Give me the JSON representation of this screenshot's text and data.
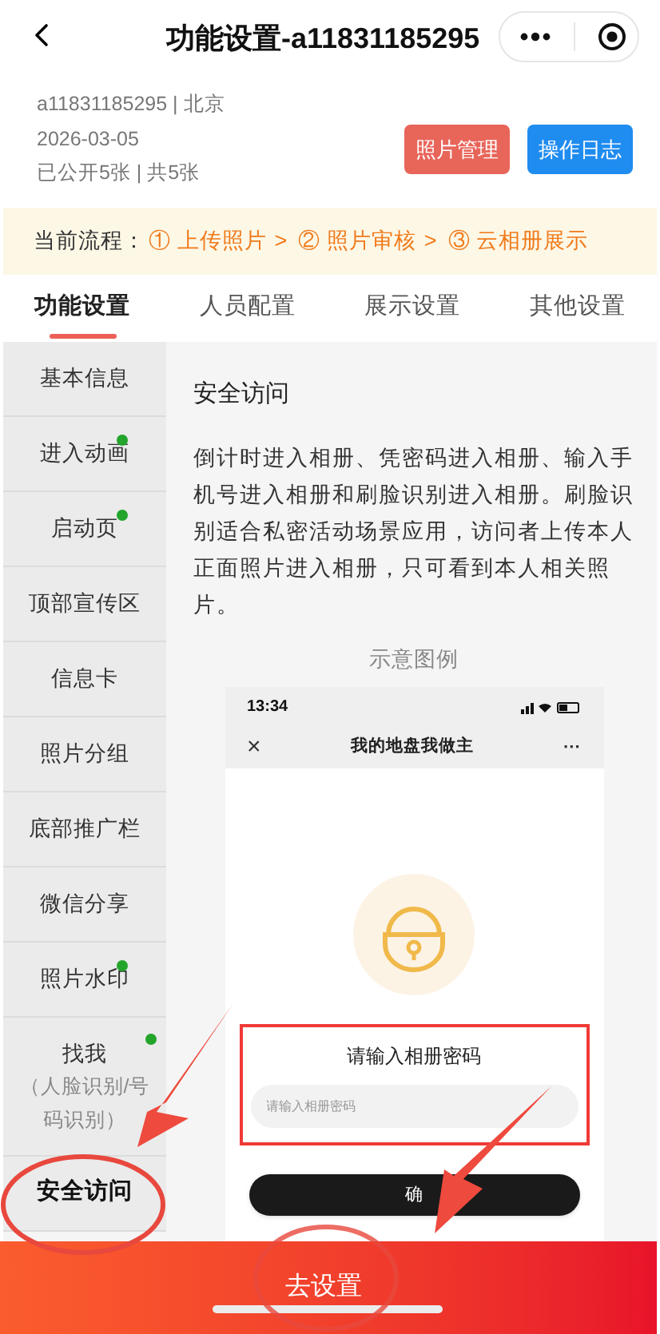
{
  "nav": {
    "title": "功能设置-a11831185295"
  },
  "album": {
    "lines": [
      "a11831185295 | 北京",
      "2026-03-05",
      "已公开5张 | 共5张"
    ],
    "buttons": [
      {
        "label": "照片管理",
        "kind": "manage"
      },
      {
        "label": "操作日志",
        "kind": "log"
      }
    ]
  },
  "flow": {
    "label": "当前流程：",
    "steps": [
      {
        "num": "①",
        "label": "上传照片"
      },
      {
        "num": "②",
        "label": "照片审核"
      },
      {
        "num": "③",
        "label": "云相册展示"
      }
    ],
    "separator": ">"
  },
  "tabs": [
    {
      "label": "功能设置",
      "selected": true
    },
    {
      "label": "人员配置",
      "selected": false
    },
    {
      "label": "展示设置",
      "selected": false
    },
    {
      "label": "其他设置",
      "selected": false
    }
  ],
  "sidebar": {
    "items": [
      {
        "label": "基本信息",
        "dot": false,
        "selected": false
      },
      {
        "label": "进入动画",
        "dot": true,
        "selected": false
      },
      {
        "label": "启动页",
        "dot": true,
        "selected": false
      },
      {
        "label": "顶部宣传区",
        "dot": false,
        "selected": false
      },
      {
        "label": "信息卡",
        "dot": false,
        "selected": false
      },
      {
        "label": "照片分组",
        "dot": false,
        "selected": false
      },
      {
        "label": "底部推广栏",
        "dot": false,
        "selected": false
      },
      {
        "label": "微信分享",
        "dot": false,
        "selected": false
      },
      {
        "label": "照片水印",
        "dot": true,
        "selected": false
      },
      {
        "label": "找我",
        "sub": "（人脸识别/号码识别）",
        "dot": true,
        "selected": false
      },
      {
        "label": "安全访问",
        "dot": false,
        "selected": true
      }
    ]
  },
  "content": {
    "title": "安全访问",
    "description": "倒计时进入相册、凭密码进入相册、输入手机号进入相册和刷脸识别进入相册。刷脸识别适合私密活动场景应用，访问者上传本人正面照片进入相册，只可看到本人相关照片。",
    "example_label": "示意图例",
    "example": {
      "time": "13:34",
      "title": "我的地盘我做主",
      "menu": "···",
      "close": "×",
      "prompt": "请输入相册密码",
      "placeholder": "请输入相册密码",
      "confirm": "确"
    }
  },
  "bottom_button": "去设置"
}
